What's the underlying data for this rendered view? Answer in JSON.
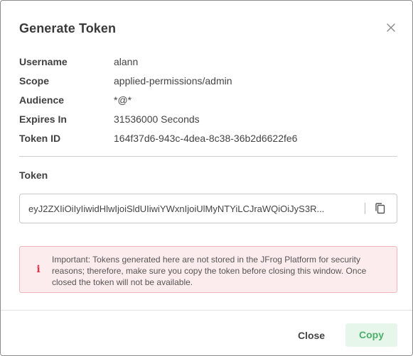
{
  "dialog": {
    "title": "Generate Token",
    "close_icon": "close-icon"
  },
  "details": [
    {
      "label": "Username",
      "value": "alann"
    },
    {
      "label": "Scope",
      "value": "applied-permissions/admin"
    },
    {
      "label": "Audience",
      "value": "*@*"
    },
    {
      "label": "Expires In",
      "value": "31536000 Seconds"
    },
    {
      "label": "Token ID",
      "value": "164f37d6-943c-4dea-8c38-36b2d6622fe6"
    }
  ],
  "token": {
    "label": "Token",
    "value": "eyJ2ZXIiOiIyIiwidHlwIjoiSldUIiwiYWxnIjoiUlMyNTYiLCJraWQiOiJyS3R...",
    "copy_icon": "copy-icon"
  },
  "alert": {
    "icon": "i",
    "text": "Important: Tokens generated here are not stored in the JFrog Platform for security reasons; therefore, make sure you copy the token before closing this window. Once closed the token will not be available."
  },
  "footer": {
    "close_label": "Close",
    "copy_label": "Copy"
  },
  "colors": {
    "accent": "#4caf6a",
    "accent_bg": "#e6f6ea",
    "alert_bg": "#fdecee",
    "alert_border": "#f3b6bd",
    "alert_icon": "#e0364a"
  }
}
